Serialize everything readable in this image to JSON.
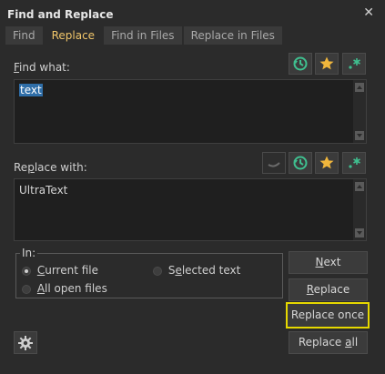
{
  "window": {
    "title": "Find and Replace",
    "close_glyph": "✕"
  },
  "tabs": [
    {
      "label": "Find",
      "active": false
    },
    {
      "label": "Replace",
      "active": true
    },
    {
      "label": "Find in Files",
      "active": false
    },
    {
      "label": "Replace in Files",
      "active": false
    }
  ],
  "find": {
    "label_mnemonic": "F",
    "label_rest": "ind what:",
    "value": "text",
    "icons": [
      "history-icon",
      "favorites-star-icon",
      "regex-icon"
    ]
  },
  "replace": {
    "label_pre": "Re",
    "label_mnemonic": "p",
    "label_rest": "lace with:",
    "value": "UltraText",
    "icons": [
      "toggle-icon",
      "history-icon",
      "favorites-star-icon",
      "regex-icon"
    ]
  },
  "scope": {
    "group_label": "In:",
    "options": [
      {
        "mnemonic": "C",
        "rest": "urrent file",
        "selected": true
      },
      {
        "pre": "S",
        "mnemonic": "e",
        "rest": "lected text",
        "selected": false
      },
      {
        "mnemonic": "A",
        "rest": "ll open files",
        "selected": false
      }
    ]
  },
  "buttons": {
    "next": {
      "mnemonic": "N",
      "rest": "ext"
    },
    "replace": {
      "mnemonic": "R",
      "rest": "eplace"
    },
    "replace_once": "Replace once",
    "replace_all": {
      "pre": "Replace ",
      "mnemonic": "a",
      "rest": "ll"
    }
  },
  "colors": {
    "accent_tab": "#f1c66a",
    "focus_outline": "#e6d800",
    "selection": "#2f6ea8",
    "icon_green": "#3fbf8f",
    "icon_gold": "#f0b63c"
  }
}
